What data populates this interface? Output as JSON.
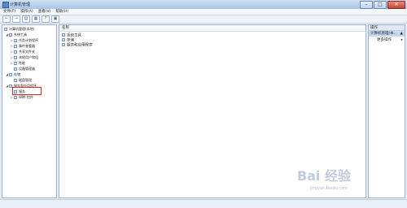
{
  "window": {
    "title": "计算机管理",
    "buttons": {
      "minimize": "–",
      "maximize": "□",
      "close": "✕"
    }
  },
  "menu": [
    "文件(F)",
    "操作(A)",
    "查看(V)",
    "帮助(H)"
  ],
  "toolbar": [
    "←",
    "→",
    "▤",
    "▦",
    "?",
    "▣"
  ],
  "tree": {
    "root": "计算机管理(本地)",
    "system_tools": "系统工具",
    "system_children": [
      "任务计划程序",
      "事件查看器",
      "共享文件夹",
      "本地用户和组",
      "性能",
      "设备管理器"
    ],
    "storage": "存储",
    "storage_children": [
      "磁盘管理"
    ],
    "services": "服务和应用程序",
    "services_children": [
      "服务",
      "WMI 控件"
    ]
  },
  "center": {
    "column_name": "名称",
    "items": [
      "系统工具",
      "存储",
      "服务和应用程序"
    ]
  },
  "actions": {
    "header": "操作",
    "subheader": "计算机管理(本...",
    "more": "更多操作",
    "chevron": "▲",
    "more_chevron": "▸"
  },
  "watermark": {
    "brand": "Bai 经验",
    "url": "jingyan.baidu.com"
  },
  "colors": {
    "highlight": "#e02424"
  }
}
